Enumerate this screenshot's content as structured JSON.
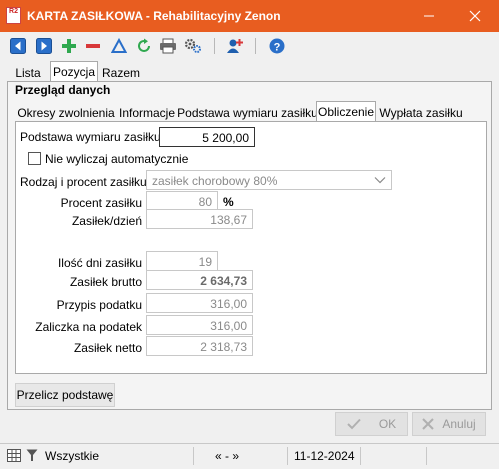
{
  "window": {
    "logo_text": "R2",
    "title": "KARTA ZASIŁKOWA - Rehabilitacyjny Zenon",
    "title_color": "#e85d20"
  },
  "toolbar": {
    "icons": [
      "arrow-left-icon",
      "arrow-right-icon",
      "plus-icon",
      "minus-icon",
      "triangle-icon",
      "refresh-icon",
      "printer-icon",
      "gears-icon",
      "user-add-icon",
      "help-icon"
    ]
  },
  "top_tabs": [
    "Lista",
    "Pozycja",
    "Razem"
  ],
  "group": {
    "title": "Przegląd danych"
  },
  "inner_tabs": [
    "Okresy zwolnienia",
    "Informacje",
    "Podstawa wymiaru zasiłku",
    "Obliczenie",
    "Wypłata zasiłku"
  ],
  "form": {
    "podstawa_label": "Podstawa wymiaru zasiłku",
    "podstawa_value": "5 200,00",
    "auto_label": "Nie wyliczaj automatycznie",
    "auto_checked": false,
    "rodzaj_label": "Rodzaj i procent zasiłku",
    "rodzaj_value": "zasiłek chorobowy 80%",
    "procent_label": "Procent zasiłku",
    "procent_value": "80",
    "procent_unit": "%",
    "dzien_label": "Zasiłek/dzień",
    "dzien_value": "138,67",
    "ilosc_label": "Ilość dni zasiłku",
    "ilosc_value": "19",
    "brutto_label": "Zasiłek brutto",
    "brutto_value": "2 634,73",
    "przypis_label": "Przypis podatku",
    "przypis_value": "316,00",
    "zaliczka_label": "Zaliczka na podatek",
    "zaliczka_value": "316,00",
    "netto_label": "Zasiłek netto",
    "netto_value": "2 318,73"
  },
  "buttons": {
    "recalc": "Przelicz podstawę",
    "ok": "OK",
    "cancel": "Anuluj"
  },
  "statusbar": {
    "filter": "Wszystkie",
    "nav": "« - »",
    "date": "11-12-2024"
  }
}
